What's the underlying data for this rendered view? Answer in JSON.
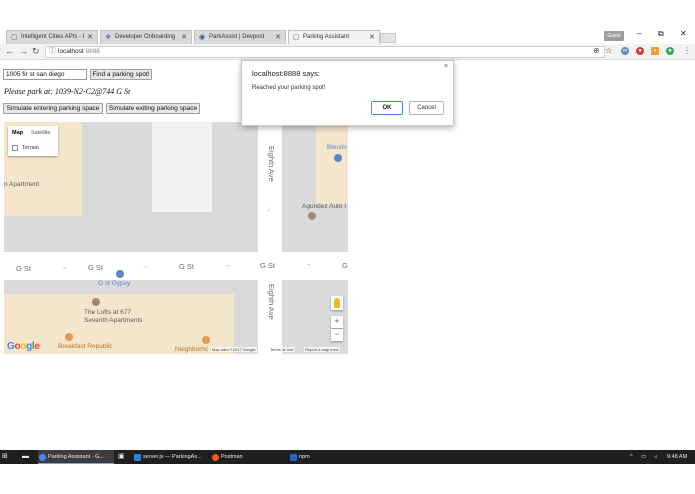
{
  "browser": {
    "tabs": [
      {
        "label": "Intelligent Cities APIs - I",
        "active": false
      },
      {
        "label": "Developer Onboarding",
        "active": false
      },
      {
        "label": "ParkAssist | Devpost",
        "active": false
      },
      {
        "label": "Parking Assistant",
        "active": true
      }
    ],
    "user_badge": "Guest",
    "url_host": "localhost",
    "url_port": ":8888"
  },
  "page": {
    "address_value": "1005 fir st san diego",
    "find_button": "Find a parking spot!",
    "park_text": "Please park at: 1039-N2-C2@744 G St",
    "enter_button": "Simulate entering parking space",
    "exit_button": "Simulate exiting parking space"
  },
  "map": {
    "type_map": "Map",
    "type_satellite": "Satellite",
    "terrain": "Terrain",
    "labels": {
      "apartment": "n Apartment",
      "blends": "Blends",
      "agundez": "Agundez Auto I",
      "gst_gypsy": "G st Gypsy",
      "lofts": "The Lofts at 677 Seventh Apartments",
      "breakfast": "Breakfast Republic",
      "neighborhood": "Neighborhc"
    },
    "streets": {
      "g_st": "G St",
      "g_st_cut": "G",
      "eighth_ave": "Eighth Ave"
    },
    "footer": {
      "map_data": "Map data ©2017 Google",
      "terms": "Terms of Use",
      "report": "Report a map error"
    },
    "google": "Google"
  },
  "dialog": {
    "title": "localhost:8888 says:",
    "message": "Reached your parking spot!",
    "ok": "OK",
    "cancel": "Cancel"
  },
  "taskbar": {
    "items": [
      "Parking Assistant - G...",
      "server.js — ParkingAs...",
      "Postman",
      "npm"
    ],
    "time": "9:48 AM"
  },
  "colors": {
    "map_road": "#ffffff",
    "map_block_gray": "#dadada",
    "map_block_tan": "#f4e6cc",
    "poi_brown": "#a5876a",
    "poi_orange": "#e39b4f",
    "poi_blue": "#5a85c8",
    "ok_border": "#4a90e2"
  }
}
